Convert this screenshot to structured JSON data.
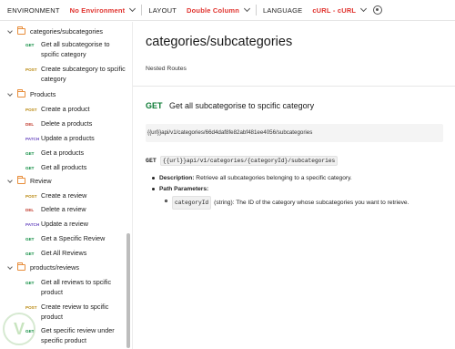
{
  "topbar": {
    "environment_label": "ENVIRONMENT",
    "environment_value": "No Environment",
    "layout_label": "LAYOUT",
    "layout_value": "Double Column",
    "language_label": "LANGUAGE",
    "language_value": "cURL - cURL",
    "settings_icon": "gear-icon",
    "accent_color": "#e0322d"
  },
  "sidebar": {
    "folders": [
      {
        "name": "categories/subcategories"
      },
      {
        "name": "Products"
      },
      {
        "name": "Review"
      },
      {
        "name": "products/reviews"
      }
    ],
    "requests": [
      {
        "method": "GET",
        "label": "Get all subcategorise to spcific category"
      },
      {
        "method": "POST",
        "label": "Create subcategory to spcific category"
      },
      {
        "method": "POST",
        "label": "Create a product"
      },
      {
        "method": "DEL",
        "label": "Delete a products"
      },
      {
        "method": "PATCH",
        "label": "Update a products"
      },
      {
        "method": "GET",
        "label": "Get a products"
      },
      {
        "method": "GET",
        "label": "Get all products"
      },
      {
        "method": "POST",
        "label": "Create a review"
      },
      {
        "method": "DEL",
        "label": "Delete a review"
      },
      {
        "method": "PATCH",
        "label": "Update a review"
      },
      {
        "method": "GET",
        "label": "Get a Specific Review"
      },
      {
        "method": "GET",
        "label": "Get All Reviews"
      },
      {
        "method": "GET",
        "label": "Get all reviews to spcific product"
      },
      {
        "method": "POST",
        "label": "Create review to spcific product"
      },
      {
        "method": "GET",
        "label": "Get specific review under specific product"
      }
    ],
    "method_colors": {
      "GET": "#0a8a3d",
      "POST": "#b8860b",
      "DEL": "#c0392b",
      "PATCH": "#6b4cc0"
    }
  },
  "main": {
    "title": "categories/subcategories",
    "description": "Nested Routes",
    "request": {
      "method": "GET",
      "name": "Get all subcategorise to spcific category",
      "url": "{{url}}api/v1/categories/66d4daf8fe82abf481ee4056/subcategories",
      "line_method": "GET",
      "line_path": "{{url}}api/v1/categories/{categoryId}/subcategories"
    },
    "details": {
      "description_label": "Description:",
      "description_text": " Retrieve all subcategories belonging to a specific category.",
      "params_label": "Path Parameters:",
      "param_name": "categoryId",
      "param_text": "(string): The ID of the category whose subcategories you want to retrieve."
    }
  }
}
